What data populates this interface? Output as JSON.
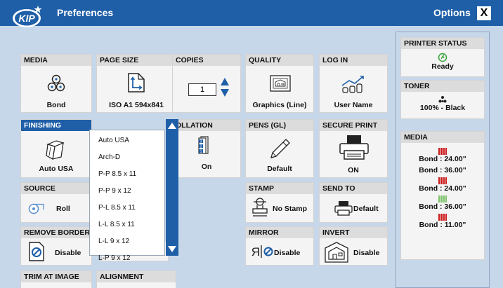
{
  "app": {
    "title": "Preferences",
    "options_label": "Options",
    "close_label": "X",
    "logo_text": "KIP"
  },
  "tiles": {
    "media": {
      "header": "MEDIA",
      "value": "Bond"
    },
    "page_size": {
      "header": "PAGE SIZE",
      "value": "ISO A1 594x841"
    },
    "copies": {
      "header": "COPIES",
      "value": "1"
    },
    "quality": {
      "header": "QUALITY",
      "value": "Graphics (Line)"
    },
    "log_in": {
      "header": "LOG IN",
      "value": "User Name"
    },
    "finishing": {
      "header": "FINISHING",
      "value": "Auto USA"
    },
    "collation": {
      "header": "OLLATION",
      "value": "On"
    },
    "pens": {
      "header": "PENS (GL)",
      "value": "Default"
    },
    "secure_print": {
      "header": "SECURE PRINT",
      "value": "ON"
    },
    "source": {
      "header": "SOURCE",
      "value": "Roll"
    },
    "stamp": {
      "header": "STAMP",
      "value": "No Stamp"
    },
    "send_to": {
      "header": "SEND TO",
      "value": "Default"
    },
    "remove_borders": {
      "header": "REMOVE BORDERS",
      "value": "Disable"
    },
    "mirror": {
      "header": "MIRROR",
      "value": "Disable"
    },
    "invert": {
      "header": "INVERT",
      "value": "Disable"
    },
    "trim_at_image": {
      "header": "TRIM AT IMAGE"
    },
    "alignment": {
      "header": "ALIGNMENT"
    }
  },
  "finishing_dropdown": {
    "options": [
      "Auto USA",
      "Arch-D",
      "P-P  8.5 x 11",
      "P-P  9 x 12",
      "P-L  8.5 x 11",
      "L-L  8.5 x 11",
      "L-L  9 x 12",
      "L-P  9 x 12"
    ]
  },
  "status": {
    "printer_status": {
      "header": "PRINTER STATUS",
      "value": "Ready"
    },
    "toner": {
      "header": "TONER",
      "value": "100% - Black"
    },
    "media": {
      "header": "MEDIA",
      "rolls": [
        "Bond : 24.00\"",
        "Bond : 36.00\"",
        "Bond : 24.00\"",
        "Bond : 36.00\"",
        "Bond : 11.00\""
      ]
    }
  },
  "colors": {
    "accent": "#1f5fa8",
    "background": "#c7d7ea",
    "roll_red": "#cc1b1b",
    "roll_green": "#7cc26a"
  }
}
